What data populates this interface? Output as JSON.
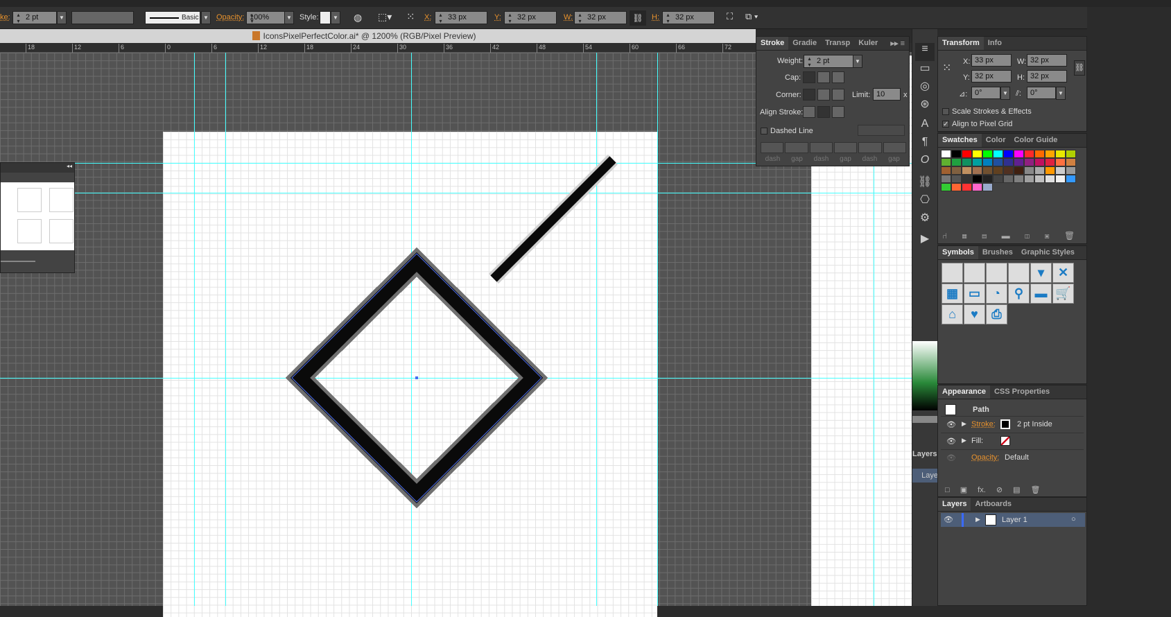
{
  "control_bar": {
    "stroke_label": "ke:",
    "stroke_weight": "2 pt",
    "brush": "Basic",
    "opacity_label": "Opacity:",
    "opacity": "100%",
    "style_label": "Style:",
    "x_label": "X:",
    "x": "33 px",
    "y_label": "Y:",
    "y": "32 px",
    "w_label": "W:",
    "w": "32 px",
    "h_label": "H:",
    "h": "32 px"
  },
  "document": {
    "title": "IconsPixelPerfectColor.ai* @ 1200% (RGB/Pixel Preview)",
    "ai_badge": "Ai"
  },
  "ruler": {
    "ticks": [
      "18",
      "12",
      "6",
      "0",
      "6",
      "12",
      "18",
      "24",
      "30",
      "36",
      "42",
      "48",
      "54",
      "60",
      "66",
      "72"
    ]
  },
  "stroke_panel": {
    "tabs": [
      "Stroke",
      "Gradie",
      "Transp",
      "Kuler"
    ],
    "weight_label": "Weight:",
    "weight": "2 pt",
    "cap_label": "Cap:",
    "corner_label": "Corner:",
    "limit_label": "Limit:",
    "limit": "10",
    "limit_unit": "x",
    "align_label": "Align Stroke:",
    "dashed_label": "Dashed Line",
    "dashed_checked": false,
    "dash_labels": [
      "dash",
      "gap",
      "dash",
      "gap",
      "dash",
      "gap"
    ]
  },
  "transform_panel": {
    "tabs": [
      "Transform",
      "Info"
    ],
    "x_label": "X:",
    "x": "33 px",
    "y_label": "Y:",
    "y": "32 px",
    "w_label": "W:",
    "w": "32 px",
    "h_label": "H:",
    "h": "32 px",
    "angle": "0°",
    "shear": "0°",
    "scale_strokes": "Scale Strokes & Effects",
    "scale_strokes_checked": false,
    "align_pixel": "Align to Pixel Grid",
    "align_pixel_checked": true
  },
  "swatches_panel": {
    "tabs": [
      "Swatches",
      "Color",
      "Color Guide"
    ],
    "colors": [
      "#ffffff",
      "#000000",
      "#ff0000",
      "#ffff00",
      "#00ff00",
      "#00ffff",
      "#0000ff",
      "#ff00ff",
      "#ff2a2a",
      "#ff6a00",
      "#ffa500",
      "#e8e800",
      "#b0d000",
      "#60b030",
      "#20a040",
      "#109060",
      "#00a0a0",
      "#0080c0",
      "#2050a0",
      "#303090",
      "#602090",
      "#902080",
      "#c01060",
      "#e02040",
      "#ff7040",
      "#d08040",
      "#a06030",
      "#806040",
      "#c09060",
      "#a07050",
      "#705030",
      "#604020",
      "#503020",
      "#402010",
      "#888888",
      "#aaaaaa",
      "#ff9900",
      "#cccccc",
      "#999999",
      "#777777",
      "#555555",
      "#333333",
      "#000000",
      "#222222",
      "#444444",
      "#666666",
      "#808080",
      "#a0a0a0",
      "#c0c0c0",
      "#e0e0e0",
      "#f0f0f0",
      "#3399ff",
      "#33cc33",
      "#ff6633",
      "#ff3333",
      "#ff66cc",
      "#99aacc"
    ]
  },
  "symbols_panel": {
    "tabs": [
      "Symbols",
      "Brushes",
      "Graphic Styles"
    ],
    "symbols": [
      "",
      "",
      "",
      "",
      "▾",
      "✕",
      "▦",
      "▭",
      "◔",
      "⚲",
      "▬",
      "🛒",
      "⌂",
      "♥",
      "⎙"
    ]
  },
  "appearance_panel": {
    "tabs": [
      "Appearance",
      "CSS Properties"
    ],
    "object": "Path",
    "stroke_label": "Stroke:",
    "stroke_value": "2 pt  Inside",
    "fill_label": "Fill:",
    "opacity_label": "Opacity:",
    "opacity_value": "Default"
  },
  "layers_panel": {
    "tabs": [
      "Layers",
      "Artboards"
    ],
    "layer": "Layer 1",
    "collapsed_label": "Layers",
    "collapsed_layer": "Laye"
  }
}
